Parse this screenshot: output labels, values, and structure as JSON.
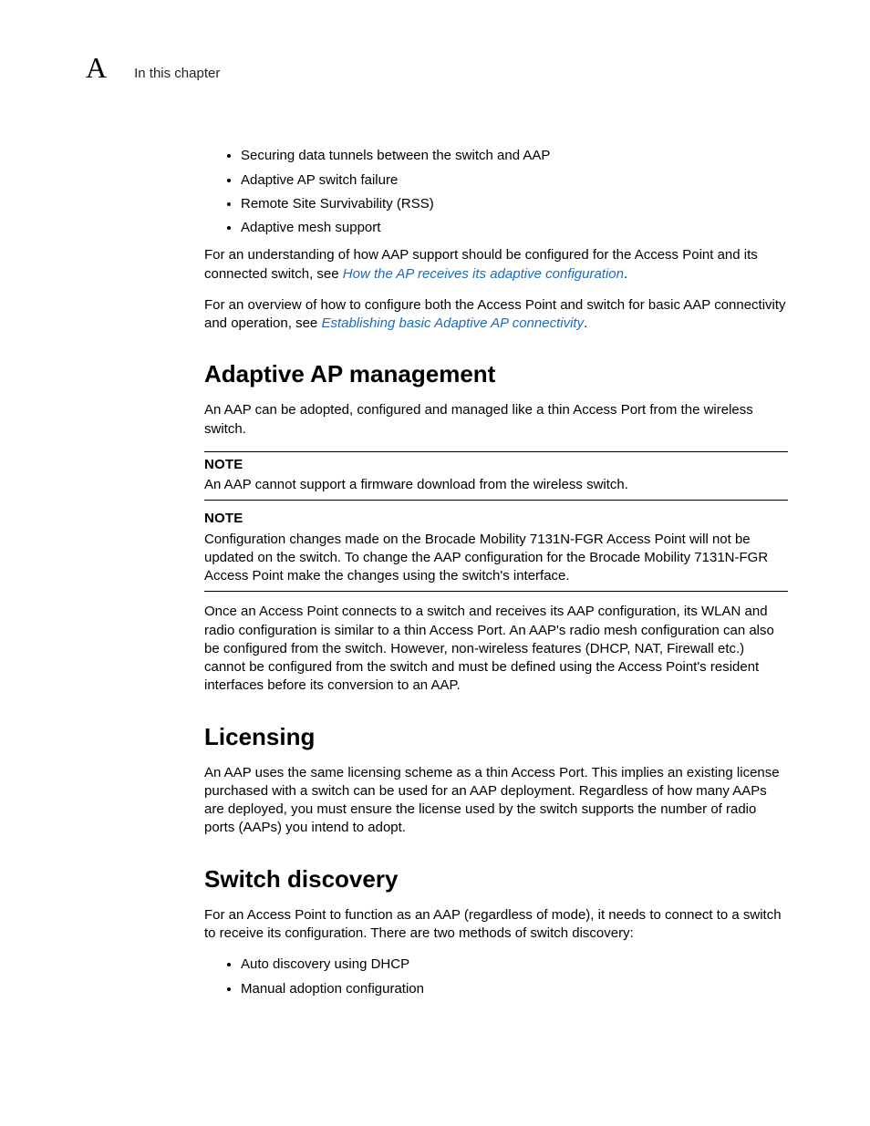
{
  "header": {
    "appendix_letter": "A",
    "running_head": "In this chapter"
  },
  "intro": {
    "bullets": [
      "Securing data tunnels between the switch and AAP",
      "Adaptive AP switch failure",
      "Remote Site Survivability (RSS)",
      "Adaptive mesh support"
    ],
    "para1_pre": "For an understanding of how AAP support should be configured for the Access Point and its connected switch, see ",
    "para1_link": "How the AP receives its adaptive configuration",
    "para1_post": ".",
    "para2_pre": "For an overview of how to configure both the Access Point and switch for basic AAP connectivity and operation, see ",
    "para2_link": "Establishing basic Adaptive AP connectivity",
    "para2_post": "."
  },
  "sections": {
    "mgmt": {
      "title": "Adaptive AP management",
      "para1": "An AAP can be adopted, configured and managed like a thin Access Port from the wireless switch.",
      "note1_label": "NOTE",
      "note1_body": "An AAP cannot support a firmware download from the wireless switch.",
      "note2_label": "NOTE",
      "note2_body": "Configuration changes made on the Brocade Mobility 7131N-FGR Access Point will not be updated on the switch. To change the AAP configuration for the Brocade Mobility 7131N-FGR Access Point make the changes using the switch's interface.",
      "para2": "Once an Access Point connects to a switch and receives its AAP configuration, its WLAN and radio configuration is similar to a thin Access Port. An AAP's radio mesh configuration can also be configured from the switch. However, non-wireless features (DHCP, NAT, Firewall etc.) cannot be configured from the switch and must be defined using the Access Point's resident interfaces before its conversion to an AAP."
    },
    "licensing": {
      "title": "Licensing",
      "para1": "An AAP uses the same licensing scheme as a thin Access Port. This implies an existing license purchased with a switch can be used for an AAP deployment. Regardless of how many AAPs are deployed, you must ensure the license used by the switch supports the number of radio ports (AAPs) you intend to adopt."
    },
    "discovery": {
      "title": "Switch discovery",
      "para1": "For an Access Point to function as an AAP (regardless of mode), it needs to connect to a switch to receive its configuration. There are two methods of switch discovery:",
      "bullets": [
        "Auto discovery using DHCP",
        "Manual adoption configuration"
      ]
    }
  }
}
